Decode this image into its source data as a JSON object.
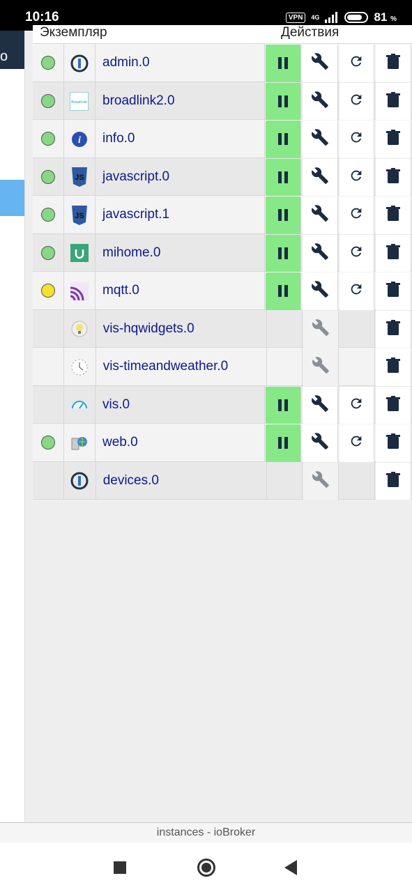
{
  "status_bar": {
    "time": "10:16",
    "vpn": "VPN",
    "network": "4G",
    "battery": "81",
    "battery_unit": "%"
  },
  "sidebar": {
    "item_glyph": "o"
  },
  "table": {
    "col_instance": "Экземпляр",
    "col_actions": "Действия",
    "rows": [
      {
        "status": "green",
        "icon": "admin-icon",
        "name": "admin.0",
        "pause": true,
        "restart": true,
        "config_active": true
      },
      {
        "status": "green",
        "icon": "broadlink-icon",
        "name": "broadlink2.0",
        "pause": true,
        "restart": true,
        "config_active": true
      },
      {
        "status": "green",
        "icon": "info-icon",
        "name": "info.0",
        "pause": true,
        "restart": true,
        "config_active": true
      },
      {
        "status": "green",
        "icon": "javascript-icon",
        "name": "javascript.0",
        "pause": true,
        "restart": true,
        "config_active": true
      },
      {
        "status": "green",
        "icon": "javascript-icon",
        "name": "javascript.1",
        "pause": true,
        "restart": true,
        "config_active": true
      },
      {
        "status": "green",
        "icon": "mihome-icon",
        "name": "mihome.0",
        "pause": true,
        "restart": true,
        "config_active": true
      },
      {
        "status": "yellow",
        "icon": "mqtt-icon",
        "name": "mqtt.0",
        "pause": true,
        "restart": true,
        "config_active": true
      },
      {
        "status": "none",
        "icon": "bulb-icon",
        "name": "vis-hqwidgets.0",
        "pause": false,
        "restart": false,
        "config_active": false
      },
      {
        "status": "none",
        "icon": "clock-icon",
        "name": "vis-timeandweather.0",
        "pause": false,
        "restart": false,
        "config_active": false
      },
      {
        "status": "none",
        "icon": "gauge-icon",
        "name": "vis.0",
        "pause": true,
        "restart": true,
        "config_active": true
      },
      {
        "status": "green",
        "icon": "globe-icon",
        "name": "web.0",
        "pause": true,
        "restart": true,
        "config_active": true
      },
      {
        "status": "none",
        "icon": "devices-icon",
        "name": "devices.0",
        "pause": false,
        "restart": false,
        "config_active": false
      }
    ]
  },
  "footer": {
    "title": "instances - ioBroker"
  },
  "colors": {
    "running": "#86e886",
    "status_green": "#87d883",
    "status_yellow": "#f5e12e",
    "name_text": "#0d1a8a",
    "icon_dark": "#1b2b40",
    "accent": "#66b4f2"
  }
}
